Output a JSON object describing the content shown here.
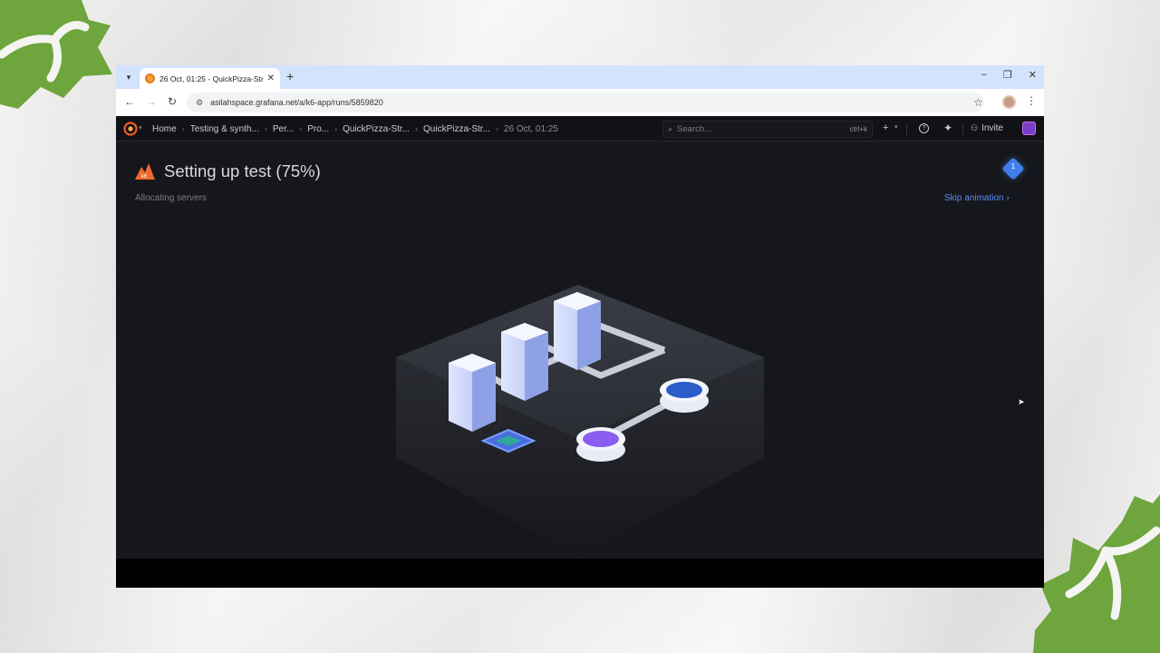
{
  "browser": {
    "tab_title": "26 Oct, 01:25 - QuickPizza-Stre",
    "url": "asilahspace.grafana.net/a/k6-app/runs/5859820",
    "new_tab_symbol": "+",
    "tab_close_symbol": "✕",
    "controls": [
      "–",
      "❐",
      "✕"
    ]
  },
  "grafana_nav": {
    "breadcrumbs": [
      "Home",
      "Testing & synth...",
      "Per...",
      "Pro...",
      "QuickPizza-Str...",
      "QuickPizza-Str...",
      "26 Oct, 01:25"
    ],
    "search_placeholder": "Search...",
    "search_shortcut": "ctrl+k",
    "invite_label": "Invite"
  },
  "page": {
    "title": "Setting up test (75%)",
    "progress_percent": 75,
    "status": "Allocating servers",
    "skip_label": "Skip animation ›",
    "badge_count": "1"
  },
  "colors": {
    "accent_link": "#5b8df0",
    "k6_orange": "#ec6a2c",
    "badge_blue": "#3f7de8",
    "deco_green": "#6ea53c"
  }
}
